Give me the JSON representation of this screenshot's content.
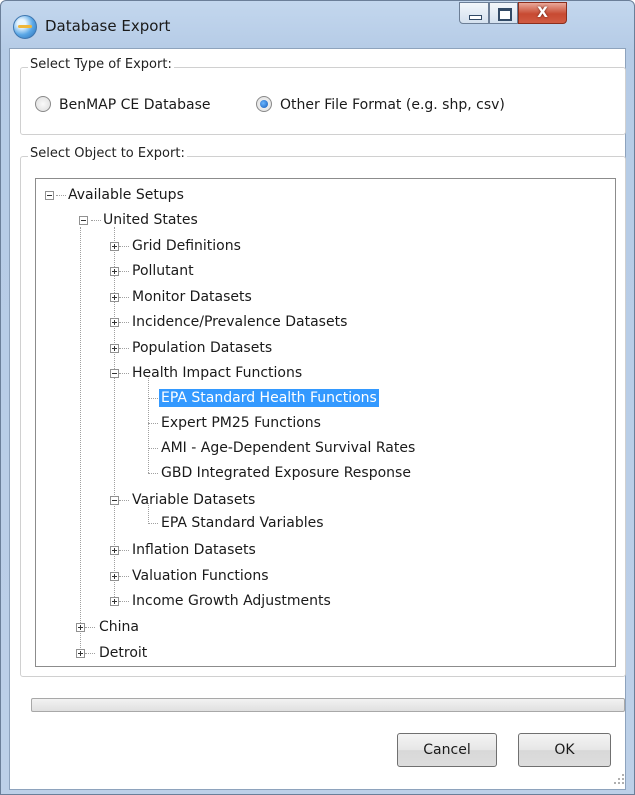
{
  "window": {
    "title": "Database Export",
    "app_icon": "globe-database-icon",
    "close_glyph": "X"
  },
  "export_type": {
    "legend": "Select Type of Export:",
    "options": [
      {
        "label": "BenMAP CE Database",
        "selected": false
      },
      {
        "label": "Other File Format (e.g. shp, csv)",
        "selected": true
      }
    ]
  },
  "object": {
    "legend": "Select Object to Export:",
    "tree": {
      "root": "Available Setups",
      "us": "United States",
      "us_children": [
        "Grid Definitions",
        "Pollutant",
        "Monitor Datasets",
        "Incidence/Prevalence Datasets",
        "Population Datasets",
        "Health Impact Functions"
      ],
      "hif_children": [
        "EPA Standard Health Functions",
        "Expert PM25 Functions",
        "AMI - Age-Dependent Survival Rates",
        "GBD Integrated Exposure Response"
      ],
      "variable": "Variable Datasets",
      "variable_children": [
        "EPA Standard Variables"
      ],
      "us_after": [
        "Inflation Datasets",
        "Valuation Functions",
        "Income Growth Adjustments"
      ],
      "others": [
        "China",
        "Detroit"
      ],
      "selected": "EPA Standard Health Functions"
    }
  },
  "buttons": {
    "cancel": "Cancel",
    "ok": "OK"
  },
  "progress": 0
}
